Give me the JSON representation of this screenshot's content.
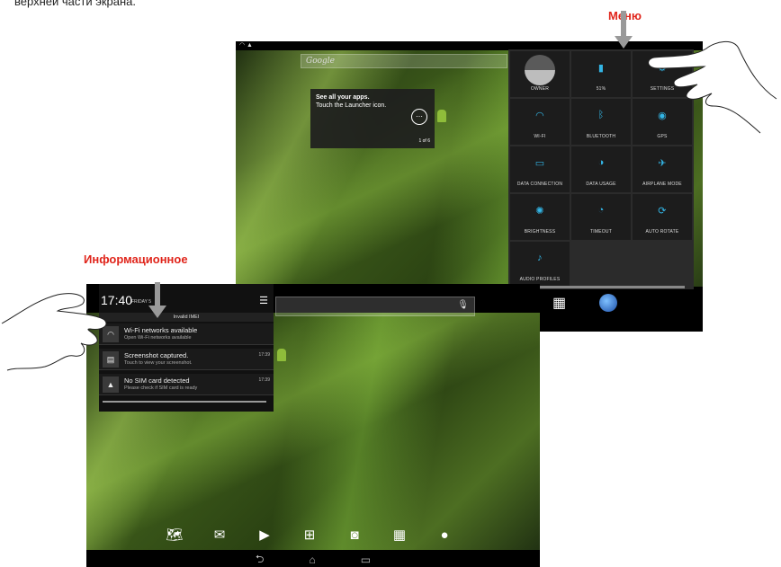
{
  "doc": {
    "top_text": "верхней части экрана."
  },
  "callouts": {
    "menu": "Меню",
    "info": "Информационное"
  },
  "top_screen": {
    "search_placeholder": "Google",
    "tip_title": "See all your apps.",
    "tip_body": "Touch the Launcher icon.",
    "tip_page": "1 of 6",
    "quick_settings": [
      {
        "label": "OWNER",
        "icon": "owner-avatar-icon",
        "glyph": ""
      },
      {
        "label": "51%",
        "icon": "battery-icon",
        "glyph": "▮"
      },
      {
        "label": "SETTINGS",
        "icon": "settings-icon",
        "glyph": "⚙"
      },
      {
        "label": "WI-FI",
        "icon": "wifi-icon",
        "glyph": "◠"
      },
      {
        "label": "BLUETOOTH",
        "icon": "bluetooth-icon",
        "glyph": "ᛒ"
      },
      {
        "label": "GPS",
        "icon": "gps-icon",
        "glyph": "◉"
      },
      {
        "label": "DATA CONNECTION",
        "icon": "data-connection-icon",
        "glyph": "▭"
      },
      {
        "label": "DATA USAGE",
        "icon": "data-usage-icon",
        "glyph": "◑"
      },
      {
        "label": "AIRPLANE MODE",
        "icon": "airplane-icon",
        "glyph": "✈"
      },
      {
        "label": "BRIGHTNESS",
        "icon": "brightness-icon",
        "glyph": "✺"
      },
      {
        "label": "TIMEOUT",
        "icon": "timeout-icon",
        "glyph": "◔"
      },
      {
        "label": "AUTO ROTATE",
        "icon": "auto-rotate-icon",
        "glyph": "⟳"
      },
      {
        "label": "AUDIO PROFILES",
        "icon": "audio-profiles-icon",
        "glyph": "♪"
      }
    ]
  },
  "bottom_screen": {
    "time": "17:40",
    "date": "FRIDAY 5",
    "invalid_imei": "Invalid IMEI",
    "notifications": [
      {
        "title": "Wi-Fi networks available",
        "subtitle": "Open Wi-Fi networks available",
        "time": "",
        "icon": "wifi-icon",
        "glyph": "◠"
      },
      {
        "title": "Screenshot captured.",
        "subtitle": "Touch to view your screenshot.",
        "time": "17:39",
        "icon": "screenshot-icon",
        "glyph": "▤"
      },
      {
        "title": "No SIM card detected",
        "subtitle": "Please check if SIM card is ready",
        "time": "17:39",
        "icon": "warning-icon",
        "glyph": "▲"
      }
    ],
    "dock": [
      {
        "icon": "maps-icon",
        "glyph": "🗺"
      },
      {
        "icon": "gmail-icon",
        "glyph": "✉"
      },
      {
        "icon": "play-store-icon",
        "glyph": "▶"
      },
      {
        "icon": "launcher-icon",
        "glyph": "⊞"
      },
      {
        "icon": "camera-icon",
        "glyph": "◙"
      },
      {
        "icon": "video-icon",
        "glyph": "▦"
      },
      {
        "icon": "browser-icon",
        "glyph": "●"
      }
    ],
    "nav": [
      {
        "icon": "back-icon",
        "glyph": "⮌"
      },
      {
        "icon": "home-icon",
        "glyph": "⌂"
      },
      {
        "icon": "recents-icon",
        "glyph": "▭"
      }
    ]
  }
}
